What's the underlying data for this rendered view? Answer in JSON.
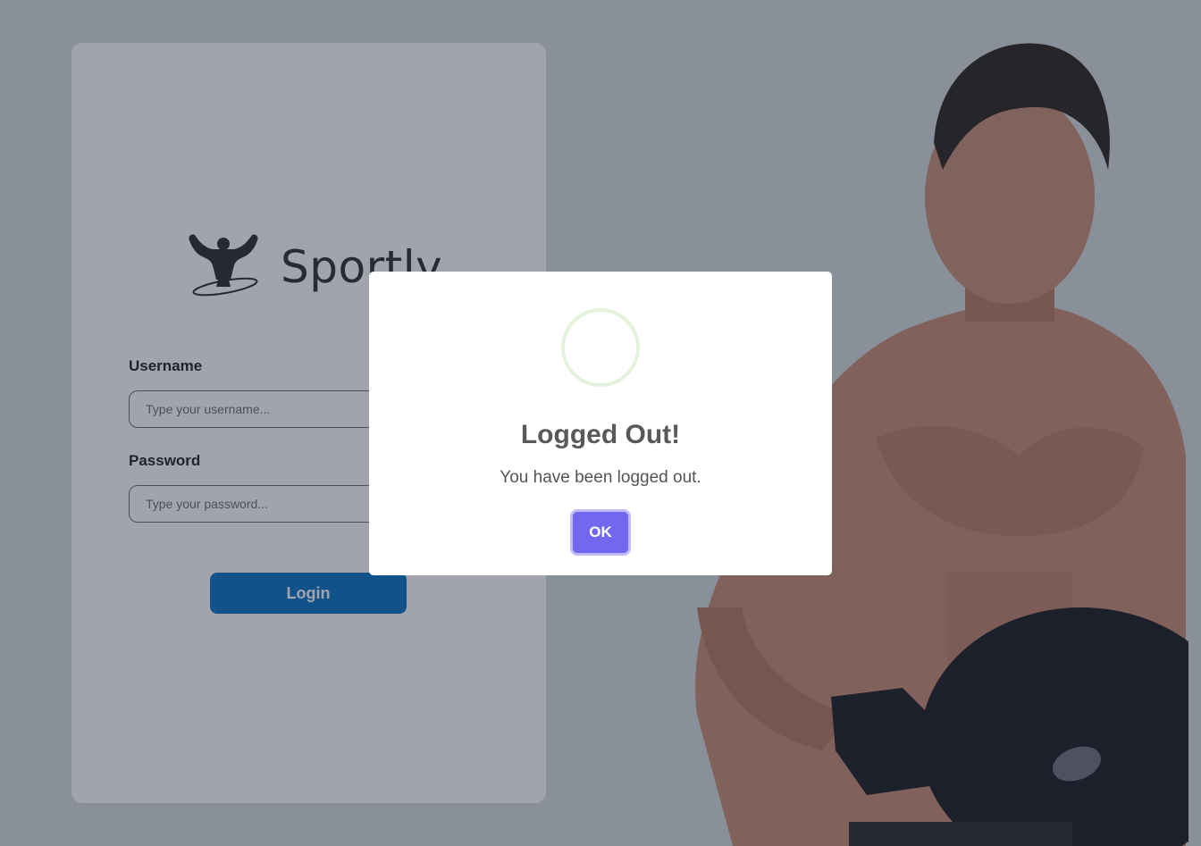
{
  "brand": {
    "name": "Sportly",
    "logo_icon": "bodybuilder-logo-icon"
  },
  "login_form": {
    "username_label": "Username",
    "username_placeholder": "Type your username...",
    "username_value": "",
    "password_label": "Password",
    "password_placeholder": "Type your password...",
    "password_value": "",
    "login_button": "Login"
  },
  "modal": {
    "icon": "success-circle-icon",
    "title": "Logged Out!",
    "message": "You have been logged out.",
    "ok_button": "OK"
  },
  "colors": {
    "login_button": "#0a70c8",
    "ok_button": "#7367f0",
    "success_ring": "#a5dc86"
  }
}
